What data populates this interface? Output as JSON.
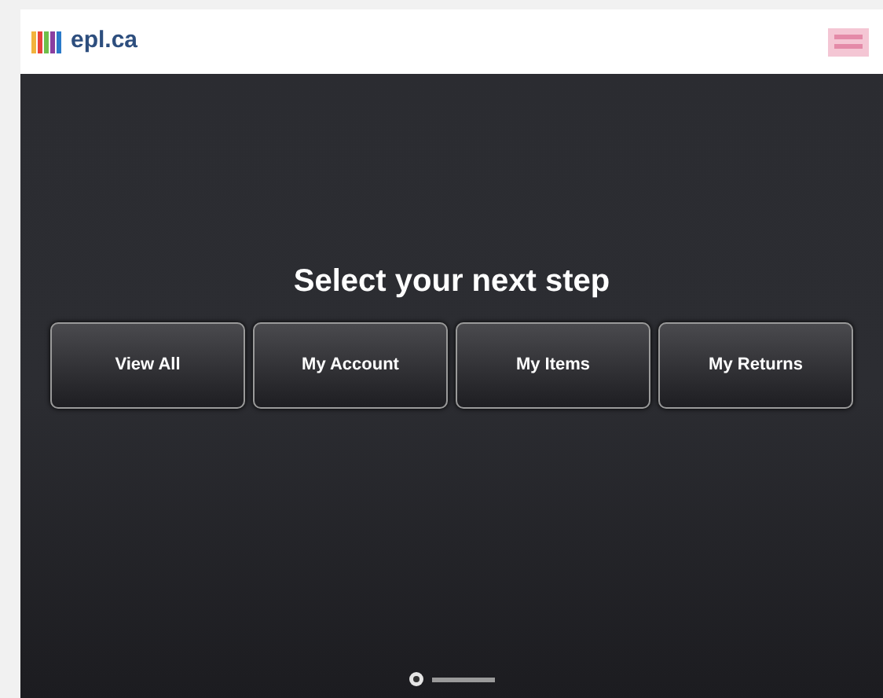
{
  "header": {
    "logo_text": "epl.ca"
  },
  "prompt": "Select your next step",
  "buttons": [
    "View All",
    "My Account",
    "My Items",
    "My Returns"
  ]
}
